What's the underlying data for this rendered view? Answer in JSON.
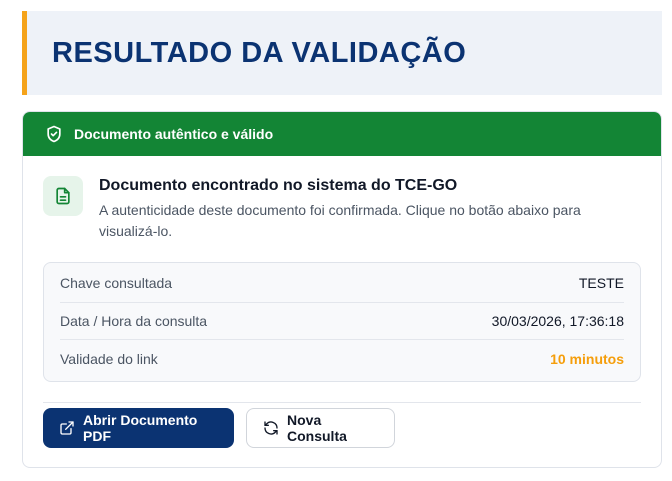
{
  "page": {
    "title": "RESULTADO DA VALIDAÇÃO"
  },
  "status": {
    "label": "Documento autêntico e válido",
    "icon": "shield-check-icon",
    "color": "#138535"
  },
  "result": {
    "icon": "document-icon",
    "heading": "Documento encontrado no sistema do TCE-GO",
    "description": "A autenticidade deste documento foi confirmada. Clique no botão abaixo para visualizá-lo."
  },
  "details": {
    "rows": [
      {
        "label": "Chave consultada",
        "value": "TESTE"
      },
      {
        "label": "Data / Hora da consulta",
        "value": "30/03/2026, 17:36:18"
      },
      {
        "label": "Validade do link",
        "value": "10 minutos"
      }
    ]
  },
  "actions": {
    "open_pdf": {
      "label": "Abrir Documento PDF",
      "icon": "external-link-icon"
    },
    "new_query": {
      "label": "Nova Consulta",
      "icon": "refresh-icon"
    }
  },
  "colors": {
    "brand": "#0b3372",
    "accent": "#f5a31a",
    "success": "#138535",
    "highlight": "#f59e0b"
  }
}
